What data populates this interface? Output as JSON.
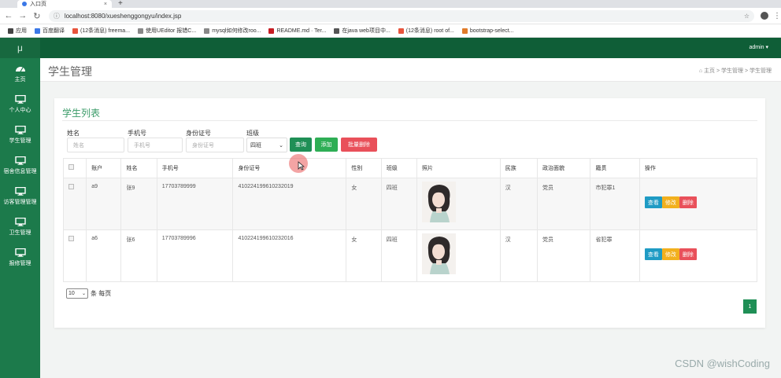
{
  "browser": {
    "tab_title": "入口页",
    "url": "localhost:8080/xueshenggongyu/index.jsp",
    "bookmarks": [
      {
        "label": "应用",
        "color": "#444"
      },
      {
        "label": "百度翻译",
        "color": "#3b78e7"
      },
      {
        "label": "(12条消息) freema...",
        "color": "#e8543c"
      },
      {
        "label": "使用UEditor 报错C...",
        "color": "#888"
      },
      {
        "label": "mysql如何修改roo...",
        "color": "#888"
      },
      {
        "label": "README.md · Ter...",
        "color": "#c71d23"
      },
      {
        "label": "在java web项目中...",
        "color": "#555"
      },
      {
        "label": "(12条消息) root of...",
        "color": "#e8543c"
      },
      {
        "label": "bootstrap-select...",
        "color": "#e07b2a"
      }
    ]
  },
  "app": {
    "logo": "μ",
    "admin": "admin ▾",
    "sidebar": [
      {
        "label": "主页",
        "icon": "dashboard-icon"
      },
      {
        "label": "个人中心",
        "icon": "monitor-icon"
      },
      {
        "label": "学生管理",
        "icon": "monitor-icon"
      },
      {
        "label": "宿舍信息管理",
        "icon": "monitor-icon"
      },
      {
        "label": "访客管理管理",
        "icon": "monitor-icon"
      },
      {
        "label": "卫生管理",
        "icon": "monitor-icon"
      },
      {
        "label": "报修管理",
        "icon": "monitor-icon"
      }
    ],
    "page_title": "学生管理",
    "breadcrumb": "⌂ 主页 > 学生管理 > 学生管理"
  },
  "panel": {
    "title": "学生列表",
    "filters": [
      {
        "label": "姓名",
        "placeholder": "姓名"
      },
      {
        "label": "手机号",
        "placeholder": "手机号"
      },
      {
        "label": "身份证号",
        "placeholder": "身份证号"
      }
    ],
    "class_filter": {
      "label": "班级",
      "value": "四班"
    },
    "buttons": {
      "search": "查询",
      "add": "添加",
      "batch_delete": "批量删除"
    },
    "columns": [
      "",
      "账户",
      "姓名",
      "手机号",
      "身份证号",
      "性别",
      "班级",
      "照片",
      "民族",
      "政治面貌",
      "籍贯",
      "操作"
    ],
    "rows": [
      {
        "account": "a9",
        "name": "张9",
        "phone": "17703789999",
        "id_card": "410224199610232019",
        "gender": "女",
        "class": "四班",
        "nation": "汉",
        "politics": "党员",
        "origin": "市犯罪1"
      },
      {
        "account": "a6",
        "name": "张6",
        "phone": "17703789996",
        "id_card": "410224199610232016",
        "gender": "女",
        "class": "四班",
        "nation": "汉",
        "politics": "党员",
        "origin": "省犯罪"
      }
    ],
    "row_actions": {
      "view": "查看",
      "edit": "修改",
      "delete": "删除"
    },
    "page_size": "10",
    "page_size_suffix": "条 每页",
    "current_page": "1"
  },
  "colors": {
    "sidebar": "#1c7a4b",
    "topbar": "#0f5e37",
    "primary": "#1f8f56",
    "danger": "#e9505a",
    "warning": "#f2b01e",
    "info": "#1f9bc4"
  },
  "watermark": "CSDN @wishCoding"
}
